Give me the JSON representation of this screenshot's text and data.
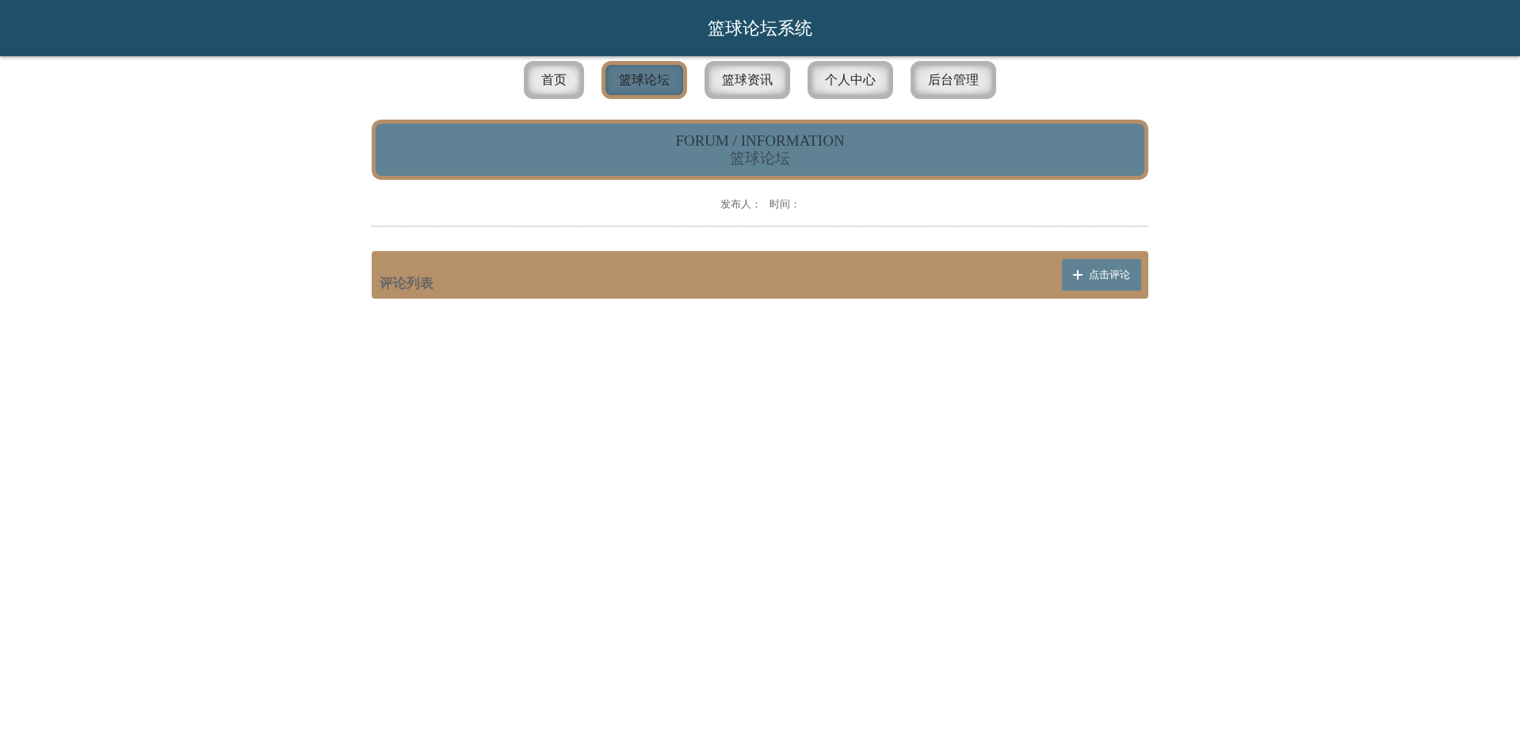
{
  "header": {
    "title": "篮球论坛系统"
  },
  "nav": [
    {
      "label": "首页",
      "selected": false
    },
    {
      "label": "篮球论坛",
      "selected": true
    },
    {
      "label": "篮球资讯",
      "selected": false
    },
    {
      "label": "个人中心",
      "selected": false
    },
    {
      "label": "后台管理",
      "selected": false
    }
  ],
  "banner": {
    "title": "FORUM / INFORMATION",
    "subtitle": "篮球论坛"
  },
  "meta": [
    "发布人：",
    "时间："
  ],
  "comments": {
    "title": "评论列表",
    "button": "点击评论"
  }
}
